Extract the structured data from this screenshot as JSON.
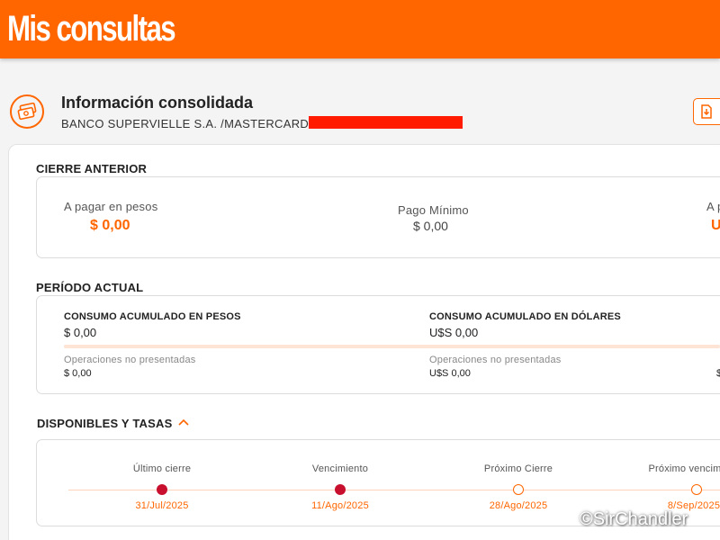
{
  "header": {
    "title": "Mis consultas"
  },
  "info": {
    "title": "Información consolidada",
    "subtitle": "BANCO SUPERVIELLE S.A. /MASTERCARD - 1",
    "icon": "money-icon",
    "download_icon": "download-document-icon"
  },
  "cierre_anterior": {
    "title": "CIERRE ANTERIOR",
    "pesos_label": "A pagar en pesos",
    "pesos_value": "$ 0,00",
    "minimo_label": "Pago Mínimo",
    "minimo_value": "$ 0,00",
    "dolares_label": "A p",
    "dolares_value": "U"
  },
  "periodo_actual": {
    "title": "PERÍODO ACTUAL",
    "pesos_title": "CONSUMO ACUMULADO EN PESOS",
    "pesos_value": "$ 0,00",
    "dolares_title": "CONSUMO ACUMULADO EN DÓLARES",
    "dolares_value": "U$S 0,00",
    "op_label": "Operaciones no presentadas",
    "op_pesos_value": "$ 0,00",
    "op_dolares_value": "U$S 0,00",
    "third_value": "$"
  },
  "disponibles": {
    "title": "DISPONIBLES Y TASAS",
    "toggle_icon": "chevron-up-icon",
    "timeline": [
      {
        "label": "Último cierre",
        "date": "31/Jul/2025",
        "state": "past"
      },
      {
        "label": "Vencimiento",
        "date": "11/Ago/2025",
        "state": "past"
      },
      {
        "label": "Próximo Cierre",
        "date": "28/Ago/2025",
        "state": "future"
      },
      {
        "label": "Próximo vencim",
        "date": "8/Sep/2025",
        "state": "future"
      }
    ]
  },
  "watermark": "©SirChandler",
  "colors": {
    "brand": "#ff6600",
    "past_dot": "#c8102e",
    "redaction": "#ff1a00"
  }
}
